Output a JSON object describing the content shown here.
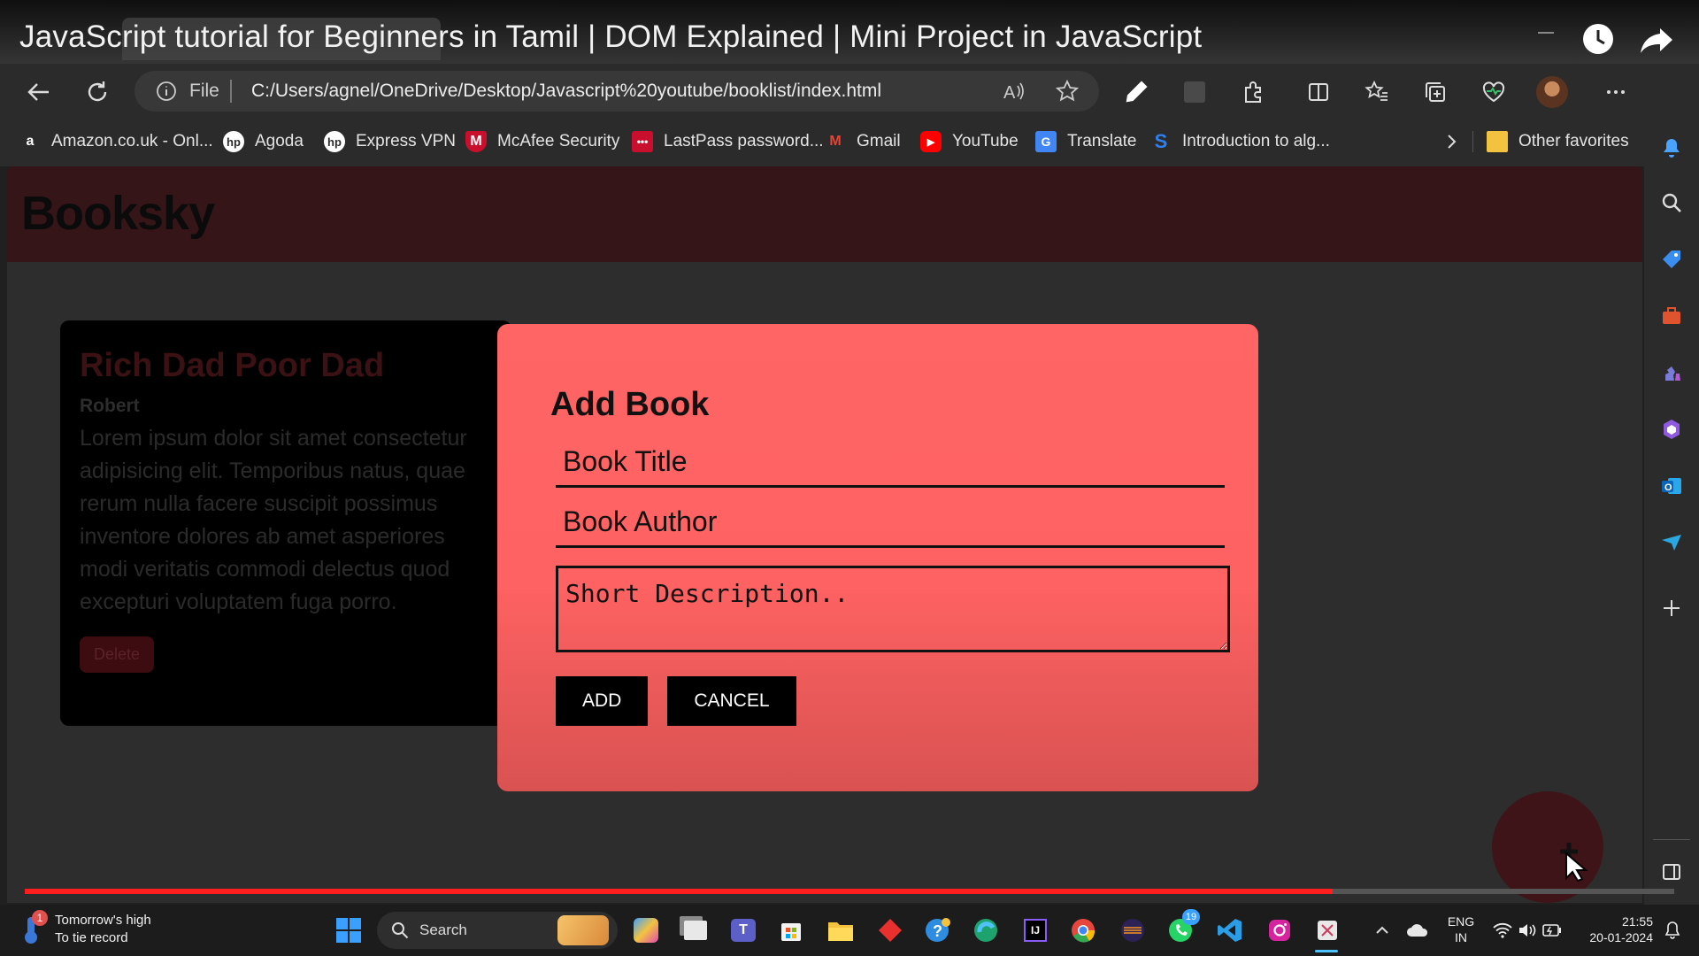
{
  "video": {
    "title": "JavaScript tutorial for Beginners in Tamil | DOM Explained | Mini Project in JavaScript"
  },
  "browser": {
    "address": {
      "scheme_label": "File",
      "url": "C:/Users/agnel/OneDrive/Desktop/Javascript%20youtube/booklist/index.html"
    },
    "bookmarks": [
      {
        "label": "Amazon.co.uk - Onl...",
        "icon": "amazon-icon"
      },
      {
        "label": "Agoda",
        "icon": "hp-icon"
      },
      {
        "label": "Express VPN",
        "icon": "hp-icon"
      },
      {
        "label": "McAfee Security",
        "icon": "mcafee-icon"
      },
      {
        "label": "LastPass password...",
        "icon": "lastpass-icon"
      },
      {
        "label": "Gmail",
        "icon": "gmail-icon"
      },
      {
        "label": "YouTube",
        "icon": "youtube-icon"
      },
      {
        "label": "Translate",
        "icon": "translate-icon"
      },
      {
        "label": "Introduction to alg...",
        "icon": "s-icon"
      }
    ],
    "other_favorites": "Other favorites"
  },
  "site": {
    "logo": "Booksky",
    "book": {
      "title": "Rich Dad Poor Dad",
      "author": "Robert",
      "description": "Lorem ipsum dolor sit amet consectetur adipisicing elit. Temporibus natus, quae rerum nulla facere suscipit possimus inventore dolores ab amet asperiores modi veritatis commodi delectus quod excepturi voluptatem fuga porro.",
      "delete_label": "Delete"
    },
    "modal": {
      "heading": "Add Book",
      "title_placeholder": "Book Title",
      "author_placeholder": "Book Author",
      "description_placeholder": "Short Description..",
      "add_label": "ADD",
      "cancel_label": "CANCEL"
    }
  },
  "taskbar": {
    "weather_line1": "Tomorrow's high",
    "weather_line2": "To tie record",
    "weather_badge": "1",
    "search_label": "Search",
    "whatsapp_badge": "19",
    "lang_line1": "ENG",
    "lang_line2": "IN",
    "time": "21:55",
    "date": "20-01-2024"
  },
  "colors": {
    "modal": "#ff6565",
    "header": "#361518",
    "progress": "#ff1d1d"
  }
}
